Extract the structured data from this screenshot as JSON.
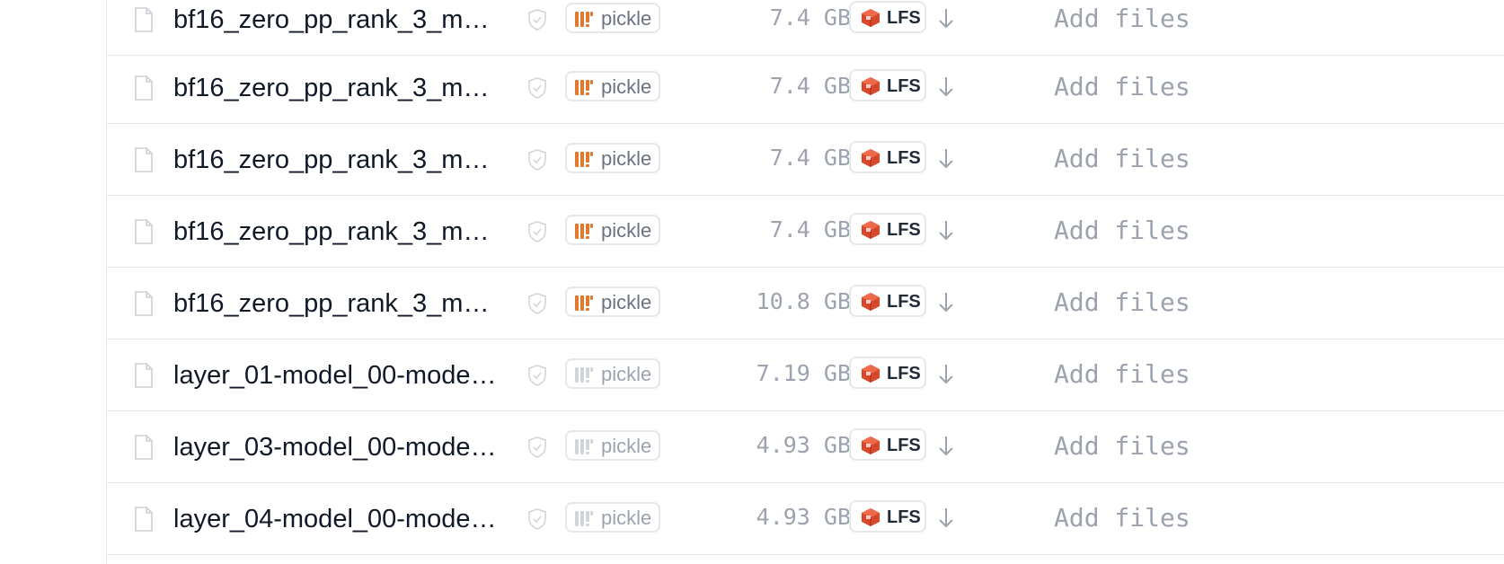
{
  "colors": {
    "border": "#e5e7eb",
    "text_primary": "#111827",
    "text_muted": "#9ca3af",
    "pickle_orange": "#e0782f",
    "pickle_gray": "#d1d5db",
    "lfs_red": "#d9482b"
  },
  "files": [
    {
      "name": "bf16_zero_pp_rank_3_m…",
      "scan_icon": "shield-check-icon",
      "format": "pickle",
      "format_icon": "pickle-icon",
      "format_active": true,
      "size": "7.4 GB",
      "storage": "LFS",
      "storage_icon": "lfs-cube-icon",
      "download_icon": "arrow-down-icon",
      "commit": "Add files"
    },
    {
      "name": "bf16_zero_pp_rank_3_m…",
      "scan_icon": "shield-check-icon",
      "format": "pickle",
      "format_icon": "pickle-icon",
      "format_active": true,
      "size": "7.4 GB",
      "storage": "LFS",
      "storage_icon": "lfs-cube-icon",
      "download_icon": "arrow-down-icon",
      "commit": "Add files"
    },
    {
      "name": "bf16_zero_pp_rank_3_m…",
      "scan_icon": "shield-check-icon",
      "format": "pickle",
      "format_icon": "pickle-icon",
      "format_active": true,
      "size": "7.4 GB",
      "storage": "LFS",
      "storage_icon": "lfs-cube-icon",
      "download_icon": "arrow-down-icon",
      "commit": "Add files"
    },
    {
      "name": "bf16_zero_pp_rank_3_m…",
      "scan_icon": "shield-check-icon",
      "format": "pickle",
      "format_icon": "pickle-icon",
      "format_active": true,
      "size": "7.4 GB",
      "storage": "LFS",
      "storage_icon": "lfs-cube-icon",
      "download_icon": "arrow-down-icon",
      "commit": "Add files"
    },
    {
      "name": "bf16_zero_pp_rank_3_m…",
      "scan_icon": "shield-check-icon",
      "format": "pickle",
      "format_icon": "pickle-icon",
      "format_active": true,
      "size": "10.8 GB",
      "storage": "LFS",
      "storage_icon": "lfs-cube-icon",
      "download_icon": "arrow-down-icon",
      "commit": "Add files"
    },
    {
      "name": "layer_01-model_00-mode…",
      "scan_icon": "shield-check-icon",
      "format": "pickle",
      "format_icon": "pickle-icon",
      "format_active": false,
      "size": "7.19 GB",
      "storage": "LFS",
      "storage_icon": "lfs-cube-icon",
      "download_icon": "arrow-down-icon",
      "commit": "Add files"
    },
    {
      "name": "layer_03-model_00-mode…",
      "scan_icon": "shield-check-icon",
      "format": "pickle",
      "format_icon": "pickle-icon",
      "format_active": false,
      "size": "4.93 GB",
      "storage": "LFS",
      "storage_icon": "lfs-cube-icon",
      "download_icon": "arrow-down-icon",
      "commit": "Add files"
    },
    {
      "name": "layer_04-model_00-mode…",
      "scan_icon": "shield-check-icon",
      "format": "pickle",
      "format_icon": "pickle-icon",
      "format_active": false,
      "size": "4.93 GB",
      "storage": "LFS",
      "storage_icon": "lfs-cube-icon",
      "download_icon": "arrow-down-icon",
      "commit": "Add files"
    }
  ]
}
